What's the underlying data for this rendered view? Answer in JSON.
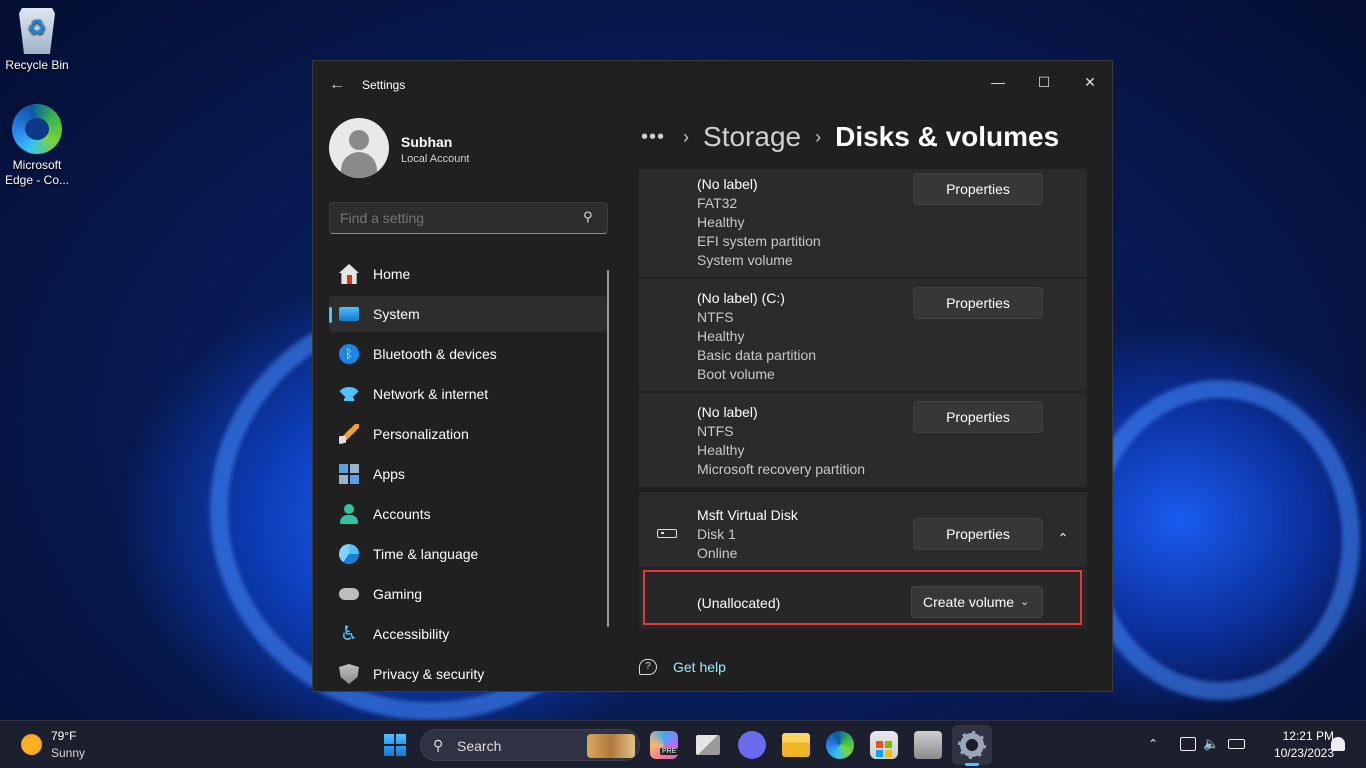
{
  "desktop": {
    "icons": [
      {
        "label": "Recycle Bin"
      },
      {
        "label": "Microsoft Edge - Co..."
      }
    ]
  },
  "window": {
    "title": "Settings",
    "controls": {
      "minimize": "—",
      "maximize": "☐",
      "close": "✕"
    },
    "back_glyph": "←"
  },
  "account": {
    "name": "Subhan",
    "type": "Local Account"
  },
  "search": {
    "placeholder": "Find a setting"
  },
  "nav": {
    "items": [
      {
        "label": "Home",
        "icon": "home-icon"
      },
      {
        "label": "System",
        "icon": "system-icon",
        "active": true
      },
      {
        "label": "Bluetooth & devices",
        "icon": "bluetooth-icon"
      },
      {
        "label": "Network & internet",
        "icon": "wifi-icon"
      },
      {
        "label": "Personalization",
        "icon": "paintbrush-icon"
      },
      {
        "label": "Apps",
        "icon": "apps-icon"
      },
      {
        "label": "Accounts",
        "icon": "person-icon"
      },
      {
        "label": "Time & language",
        "icon": "globe-clock-icon"
      },
      {
        "label": "Gaming",
        "icon": "gamepad-icon"
      },
      {
        "label": "Accessibility",
        "icon": "accessibility-icon"
      },
      {
        "label": "Privacy & security",
        "icon": "shield-icon"
      }
    ]
  },
  "breadcrumb": {
    "more": "•••",
    "parent": "Storage",
    "current": "Disks & volumes",
    "separator": "›"
  },
  "volumes": [
    {
      "lines": [
        "(No label)",
        "FAT32",
        "Healthy",
        "EFI system partition",
        "System volume"
      ],
      "button": "Properties"
    },
    {
      "lines": [
        "(No label) (C:)",
        "NTFS",
        "Healthy",
        "Basic data partition",
        "Boot volume"
      ],
      "button": "Properties"
    },
    {
      "lines": [
        "(No label)",
        "NTFS",
        "Healthy",
        "Microsoft recovery partition"
      ],
      "button": "Properties"
    }
  ],
  "disk": {
    "name": "Msft Virtual Disk",
    "number": "Disk 1",
    "status": "Online",
    "button": "Properties",
    "expanded": true
  },
  "unallocated": {
    "label": "(Unallocated)",
    "button": "Create volume"
  },
  "help": {
    "label": "Get help"
  },
  "taskbar": {
    "weather_temp": "79°F",
    "weather_condition": "Sunny",
    "search_label": "Search",
    "copilot_badge": "PRE",
    "time": "12:21 PM",
    "date": "10/23/2023"
  },
  "colors": {
    "accent": "#4cc2ff",
    "highlight_box": "#e0393e",
    "link": "#99ebff"
  }
}
